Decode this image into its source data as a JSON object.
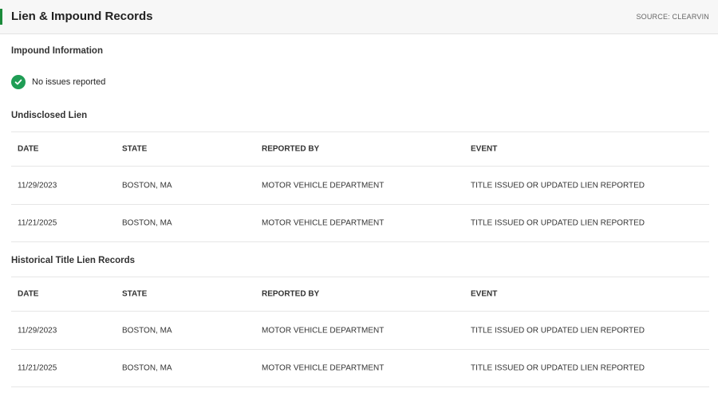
{
  "header": {
    "title": "Lien & Impound Records",
    "source": "SOURCE: CLEARVIN",
    "accent_color": "#1b8a3a"
  },
  "impound": {
    "title": "Impound Information",
    "status_icon": "check-circle-icon",
    "status_text": "No issues reported",
    "status_color": "#1f9d55"
  },
  "undisclosed_lien": {
    "title": "Undisclosed Lien",
    "columns": [
      "DATE",
      "STATE",
      "REPORTED BY",
      "EVENT"
    ],
    "rows": [
      [
        "11/29/2023",
        "BOSTON, MA",
        "MOTOR VEHICLE DEPARTMENT",
        "TITLE ISSUED OR UPDATED LIEN REPORTED"
      ],
      [
        "11/21/2025",
        "BOSTON, MA",
        "MOTOR VEHICLE DEPARTMENT",
        "TITLE ISSUED OR UPDATED LIEN REPORTED"
      ]
    ]
  },
  "historical_lien": {
    "title": "Historical Title Lien Records",
    "columns": [
      "DATE",
      "STATE",
      "REPORTED BY",
      "EVENT"
    ],
    "rows": [
      [
        "11/29/2023",
        "BOSTON, MA",
        "MOTOR VEHICLE DEPARTMENT",
        "TITLE ISSUED OR UPDATED LIEN REPORTED"
      ],
      [
        "11/21/2025",
        "BOSTON, MA",
        "MOTOR VEHICLE DEPARTMENT",
        "TITLE ISSUED OR UPDATED LIEN REPORTED"
      ]
    ]
  }
}
